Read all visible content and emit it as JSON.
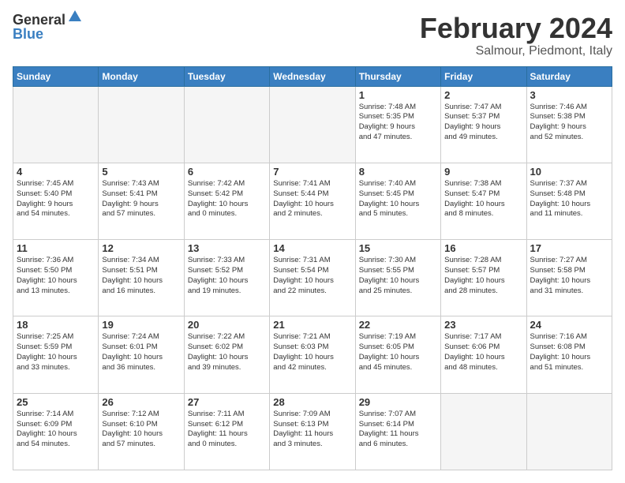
{
  "header": {
    "logo_general": "General",
    "logo_blue": "Blue",
    "month_title": "February 2024",
    "location": "Salmour, Piedmont, Italy"
  },
  "weekdays": [
    "Sunday",
    "Monday",
    "Tuesday",
    "Wednesday",
    "Thursday",
    "Friday",
    "Saturday"
  ],
  "weeks": [
    [
      {
        "day": "",
        "info": ""
      },
      {
        "day": "",
        "info": ""
      },
      {
        "day": "",
        "info": ""
      },
      {
        "day": "",
        "info": ""
      },
      {
        "day": "1",
        "info": "Sunrise: 7:48 AM\nSunset: 5:35 PM\nDaylight: 9 hours\nand 47 minutes."
      },
      {
        "day": "2",
        "info": "Sunrise: 7:47 AM\nSunset: 5:37 PM\nDaylight: 9 hours\nand 49 minutes."
      },
      {
        "day": "3",
        "info": "Sunrise: 7:46 AM\nSunset: 5:38 PM\nDaylight: 9 hours\nand 52 minutes."
      }
    ],
    [
      {
        "day": "4",
        "info": "Sunrise: 7:45 AM\nSunset: 5:40 PM\nDaylight: 9 hours\nand 54 minutes."
      },
      {
        "day": "5",
        "info": "Sunrise: 7:43 AM\nSunset: 5:41 PM\nDaylight: 9 hours\nand 57 minutes."
      },
      {
        "day": "6",
        "info": "Sunrise: 7:42 AM\nSunset: 5:42 PM\nDaylight: 10 hours\nand 0 minutes."
      },
      {
        "day": "7",
        "info": "Sunrise: 7:41 AM\nSunset: 5:44 PM\nDaylight: 10 hours\nand 2 minutes."
      },
      {
        "day": "8",
        "info": "Sunrise: 7:40 AM\nSunset: 5:45 PM\nDaylight: 10 hours\nand 5 minutes."
      },
      {
        "day": "9",
        "info": "Sunrise: 7:38 AM\nSunset: 5:47 PM\nDaylight: 10 hours\nand 8 minutes."
      },
      {
        "day": "10",
        "info": "Sunrise: 7:37 AM\nSunset: 5:48 PM\nDaylight: 10 hours\nand 11 minutes."
      }
    ],
    [
      {
        "day": "11",
        "info": "Sunrise: 7:36 AM\nSunset: 5:50 PM\nDaylight: 10 hours\nand 13 minutes."
      },
      {
        "day": "12",
        "info": "Sunrise: 7:34 AM\nSunset: 5:51 PM\nDaylight: 10 hours\nand 16 minutes."
      },
      {
        "day": "13",
        "info": "Sunrise: 7:33 AM\nSunset: 5:52 PM\nDaylight: 10 hours\nand 19 minutes."
      },
      {
        "day": "14",
        "info": "Sunrise: 7:31 AM\nSunset: 5:54 PM\nDaylight: 10 hours\nand 22 minutes."
      },
      {
        "day": "15",
        "info": "Sunrise: 7:30 AM\nSunset: 5:55 PM\nDaylight: 10 hours\nand 25 minutes."
      },
      {
        "day": "16",
        "info": "Sunrise: 7:28 AM\nSunset: 5:57 PM\nDaylight: 10 hours\nand 28 minutes."
      },
      {
        "day": "17",
        "info": "Sunrise: 7:27 AM\nSunset: 5:58 PM\nDaylight: 10 hours\nand 31 minutes."
      }
    ],
    [
      {
        "day": "18",
        "info": "Sunrise: 7:25 AM\nSunset: 5:59 PM\nDaylight: 10 hours\nand 33 minutes."
      },
      {
        "day": "19",
        "info": "Sunrise: 7:24 AM\nSunset: 6:01 PM\nDaylight: 10 hours\nand 36 minutes."
      },
      {
        "day": "20",
        "info": "Sunrise: 7:22 AM\nSunset: 6:02 PM\nDaylight: 10 hours\nand 39 minutes."
      },
      {
        "day": "21",
        "info": "Sunrise: 7:21 AM\nSunset: 6:03 PM\nDaylight: 10 hours\nand 42 minutes."
      },
      {
        "day": "22",
        "info": "Sunrise: 7:19 AM\nSunset: 6:05 PM\nDaylight: 10 hours\nand 45 minutes."
      },
      {
        "day": "23",
        "info": "Sunrise: 7:17 AM\nSunset: 6:06 PM\nDaylight: 10 hours\nand 48 minutes."
      },
      {
        "day": "24",
        "info": "Sunrise: 7:16 AM\nSunset: 6:08 PM\nDaylight: 10 hours\nand 51 minutes."
      }
    ],
    [
      {
        "day": "25",
        "info": "Sunrise: 7:14 AM\nSunset: 6:09 PM\nDaylight: 10 hours\nand 54 minutes."
      },
      {
        "day": "26",
        "info": "Sunrise: 7:12 AM\nSunset: 6:10 PM\nDaylight: 10 hours\nand 57 minutes."
      },
      {
        "day": "27",
        "info": "Sunrise: 7:11 AM\nSunset: 6:12 PM\nDaylight: 11 hours\nand 0 minutes."
      },
      {
        "day": "28",
        "info": "Sunrise: 7:09 AM\nSunset: 6:13 PM\nDaylight: 11 hours\nand 3 minutes."
      },
      {
        "day": "29",
        "info": "Sunrise: 7:07 AM\nSunset: 6:14 PM\nDaylight: 11 hours\nand 6 minutes."
      },
      {
        "day": "",
        "info": ""
      },
      {
        "day": "",
        "info": ""
      }
    ]
  ]
}
